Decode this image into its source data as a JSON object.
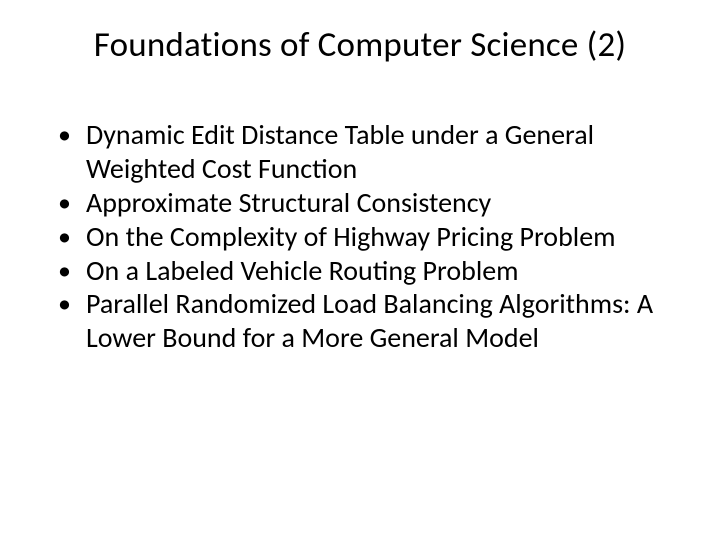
{
  "title": "Foundations of Computer Science (2)",
  "bullets": [
    "Dynamic Edit Distance Table under a General Weighted Cost Function",
    "Approximate Structural Consistency",
    "On the Complexity of Highway Pricing Problem",
    "On a Labeled Vehicle Routing Problem",
    "Parallel Randomized Load Balancing Algorithms: A Lower Bound for a More General Model"
  ]
}
